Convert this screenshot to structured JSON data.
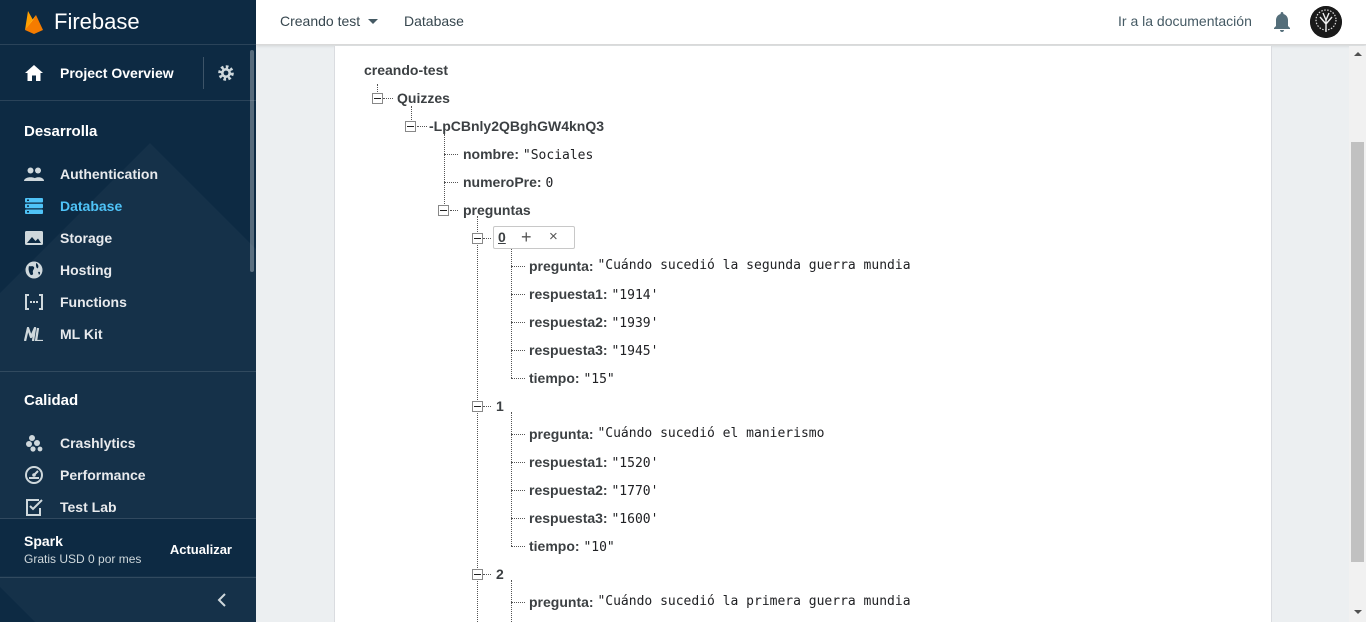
{
  "app": {
    "brand": "Firebase"
  },
  "sidebar": {
    "overview": "Project Overview",
    "sections": [
      {
        "title": "Desarrolla"
      },
      {
        "title": "Calidad"
      }
    ],
    "develop_items": [
      {
        "label": "Authentication",
        "icon": "people-icon"
      },
      {
        "label": "Database",
        "icon": "database-icon",
        "active": true
      },
      {
        "label": "Storage",
        "icon": "image-icon"
      },
      {
        "label": "Hosting",
        "icon": "globe-icon"
      },
      {
        "label": "Functions",
        "icon": "functions-icon"
      },
      {
        "label": "ML Kit",
        "icon": "ml-kit-icon"
      }
    ],
    "quality_items": [
      {
        "label": "Crashlytics",
        "icon": "crashlytics-icon"
      },
      {
        "label": "Performance",
        "icon": "performance-icon"
      },
      {
        "label": "Test Lab",
        "icon": "test-lab-icon"
      }
    ],
    "plan": {
      "name": "Spark",
      "price": "Gratis USD 0 por mes",
      "upgrade": "Actualizar"
    }
  },
  "topbar": {
    "project": "Creando test",
    "page": "Database",
    "docs": "Ir a la documentación"
  },
  "tree": {
    "root": "creando-test",
    "quizzes": "Quizzes",
    "quiz_id": "-LpCBnly2QBghGW4knQ3",
    "nombre": {
      "key": "nombre:",
      "value": "\"Sociales"
    },
    "numeroPre": {
      "key": "numeroPre:",
      "value": "0"
    },
    "preguntas": "preguntas",
    "items": [
      {
        "index": "0",
        "pregunta": "\"Cuándo sucedió la segunda guerra mundia",
        "respuesta1": "\"1914'",
        "respuesta2": "\"1939'",
        "respuesta3": "\"1945'",
        "tiempo": "\"15\""
      },
      {
        "index": "1",
        "pregunta": "\"Cuándo sucedió el manierismo",
        "respuesta1": "\"1520'",
        "respuesta2": "\"1770'",
        "respuesta3": "\"1600'",
        "tiempo": "\"10\""
      },
      {
        "index": "2",
        "pregunta": "\"Cuándo sucedió la primera guerra mundia"
      }
    ],
    "labels": {
      "pregunta": "pregunta:",
      "respuesta1": "respuesta1:",
      "respuesta2": "respuesta2:",
      "respuesta3": "respuesta3:",
      "tiempo": "tiempo:"
    },
    "edit_add": "+",
    "edit_delete": "×"
  },
  "colors": {
    "sidebar_bg": "#0d2a43",
    "active": "#4fc3f7",
    "accent": "#ffa000"
  }
}
